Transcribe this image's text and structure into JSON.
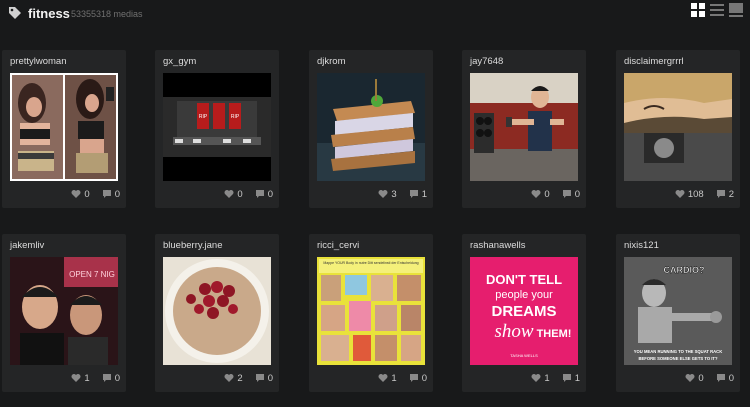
{
  "header": {
    "tag_icon": "tag-icon",
    "tag_name": "fitness",
    "media_count": "53355318 medias",
    "view_modes": [
      "grid-view-icon",
      "list-view-icon",
      "detail-view-icon"
    ],
    "accent_color": "#ffffff"
  },
  "posts": [
    {
      "user": "prettylwoman",
      "likes": "0",
      "comments": "0",
      "photo": "two women mirror selfie"
    },
    {
      "user": "gx_gym",
      "likes": "0",
      "comments": "0",
      "photo": "gym stage with red banners"
    },
    {
      "user": "djkrom",
      "likes": "3",
      "comments": "1",
      "photo": "layered sandwich"
    },
    {
      "user": "jay7648",
      "likes": "0",
      "comments": "0",
      "photo": "man with dumbbell in gym"
    },
    {
      "user": "disclaimergrrrl",
      "likes": "108",
      "comments": "2",
      "photo": "tattooed arm at gym"
    },
    {
      "user": "jakemliv",
      "likes": "1",
      "comments": "0",
      "photo": "two men selfie at night"
    },
    {
      "user": "blueberry.jane",
      "likes": "2",
      "comments": "0",
      "photo": "oatmeal with cherries"
    },
    {
      "user": "ricci_cervi",
      "likes": "1",
      "comments": "0",
      "photo": "fitness collage"
    },
    {
      "user": "rashanawells",
      "likes": "1",
      "comments": "1",
      "photo": "quote on pink background"
    },
    {
      "user": "nixis121",
      "likes": "0",
      "comments": "0",
      "photo": "vintage strongman meme"
    }
  ],
  "photo_text": {
    "quote_line1": "DON'T TELL",
    "quote_line2": "people your",
    "quote_line3": "DREAMS",
    "quote_line4": "show",
    "quote_line5": "THEM!",
    "quote_signature": "TASHA WELLS",
    "meme_top": "CARDIO?",
    "meme_bottom1": "YOU MEAN RUNNING TO THE SQUAT RACK",
    "meme_bottom2": "BEFORE SOMEONE ELSE GETS TO IT?",
    "collage_caption": "Mappe YOUR Body in nutre Ditt\nsendelinsti der Entscheidung",
    "gym_banner_text": "RIP",
    "bar_text": "OPEN 7 NIG"
  },
  "colors": {
    "page_bg": "#18191a",
    "card_bg": "#242526",
    "text_light": "#dcdcdc",
    "text_muted": "#707070",
    "icon_gray": "#8a8a8a",
    "pink_quote_bg": "#e61e6e"
  }
}
